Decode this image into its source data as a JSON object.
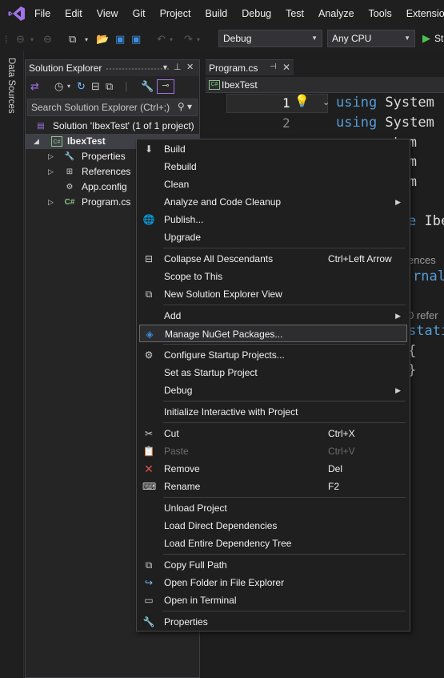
{
  "menubar": {
    "items": [
      "File",
      "Edit",
      "View",
      "Git",
      "Project",
      "Build",
      "Debug",
      "Test",
      "Analyze",
      "Tools",
      "Extensions"
    ]
  },
  "toolbar": {
    "config": "Debug",
    "platform": "Any CPU",
    "start_label": "St"
  },
  "left_strip": {
    "label": "Data Sources"
  },
  "solution_explorer": {
    "title": "Solution Explorer",
    "search_placeholder": "Search Solution Explorer (Ctrl+;)",
    "tree": [
      {
        "label": "Solution 'IbexTest' (1 of 1 project)"
      },
      {
        "label": "IbexTest"
      },
      {
        "label": "Properties"
      },
      {
        "label": "References"
      },
      {
        "label": "App.config"
      },
      {
        "label": "Program.cs"
      }
    ]
  },
  "editor": {
    "tab_title": "Program.cs",
    "nav_project": "IbexTest",
    "line_numbers": [
      "1",
      "2"
    ],
    "code": {
      "l1_kw": "using",
      "l1_rest": " System",
      "l2_kw": "using",
      "l2_rest": " System",
      "l3": "stem",
      "l4": "stem",
      "l5": "stem",
      "ns_kw": "e",
      "ns_name": " Ibe",
      "refs1": "ences",
      "internal": "rnal",
      "refs2": "0 refer",
      "static": "stati",
      "brace_open": "{",
      "brace_close": "}"
    }
  },
  "context_menu": {
    "build": "Build",
    "rebuild": "Rebuild",
    "clean": "Clean",
    "analyze": "Analyze and Code Cleanup",
    "publish": "Publish...",
    "upgrade": "Upgrade",
    "collapse": "Collapse All Descendants",
    "collapse_sc": "Ctrl+Left Arrow",
    "scope": "Scope to This",
    "new_view": "New Solution Explorer View",
    "add": "Add",
    "nuget": "Manage NuGet Packages...",
    "configure_startup": "Configure Startup Projects...",
    "set_startup": "Set as Startup Project",
    "debug": "Debug",
    "interactive": "Initialize Interactive with Project",
    "cut": "Cut",
    "cut_sc": "Ctrl+X",
    "paste": "Paste",
    "paste_sc": "Ctrl+V",
    "remove": "Remove",
    "remove_sc": "Del",
    "rename": "Rename",
    "rename_sc": "F2",
    "unload": "Unload Project",
    "load_direct": "Load Direct Dependencies",
    "load_tree": "Load Entire Dependency Tree",
    "copy_path": "Copy Full Path",
    "open_folder": "Open Folder in File Explorer",
    "open_terminal": "Open in Terminal",
    "properties": "Properties"
  },
  "colors": {
    "accent": "#a074e8",
    "keyword": "#569cd6",
    "class": "#4ec9b0",
    "menu_bg": "#1f1f1f"
  }
}
